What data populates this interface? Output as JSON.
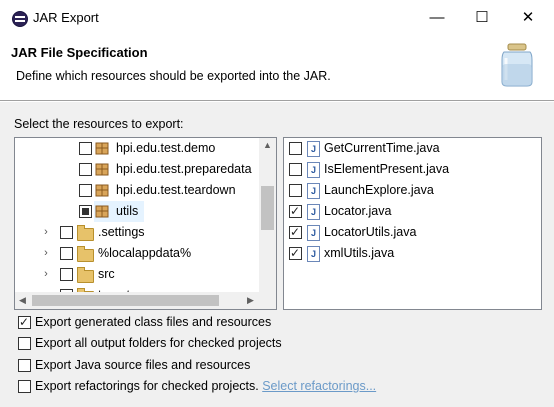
{
  "window": {
    "title": "JAR Export",
    "minimize": "—",
    "maximize": "☐",
    "close": "✕"
  },
  "header": {
    "title": "JAR File Specification",
    "description": "Define which resources should be exported into the JAR."
  },
  "resources_label": "Select the resources to export:",
  "tree_items": [
    {
      "label": "hpi.edu.test.demo",
      "type": "package",
      "checked": false
    },
    {
      "label": "hpi.edu.test.preparedata",
      "type": "package",
      "checked": false
    },
    {
      "label": "hpi.edu.test.teardown",
      "type": "package",
      "checked": false
    },
    {
      "label": "utils",
      "type": "package",
      "state": "partial",
      "selected": true
    },
    {
      "label": ".settings",
      "type": "folder",
      "checked": false
    },
    {
      "label": "%localappdata%",
      "type": "folder",
      "checked": false
    },
    {
      "label": "src",
      "type": "folder",
      "checked": false
    },
    {
      "label": "target",
      "type": "folder",
      "checked": false
    }
  ],
  "files": [
    {
      "label": "GetCurrentTime.java",
      "checked": false
    },
    {
      "label": "IsElementPresent.java",
      "checked": false
    },
    {
      "label": "LaunchExplore.java",
      "checked": false
    },
    {
      "label": "Locator.java",
      "checked": true
    },
    {
      "label": "LocatorUtils.java",
      "checked": true
    },
    {
      "label": "xmlUtils.java",
      "checked": true
    }
  ],
  "options": [
    {
      "label": "Export generated class files and resources",
      "checked": true
    },
    {
      "label": "Export all output folders for checked projects",
      "checked": false
    },
    {
      "label": "Export Java source files and resources",
      "checked": false
    },
    {
      "label": "Export refactorings for checked projects.",
      "checked": false,
      "link": "Select refactorings..."
    }
  ]
}
